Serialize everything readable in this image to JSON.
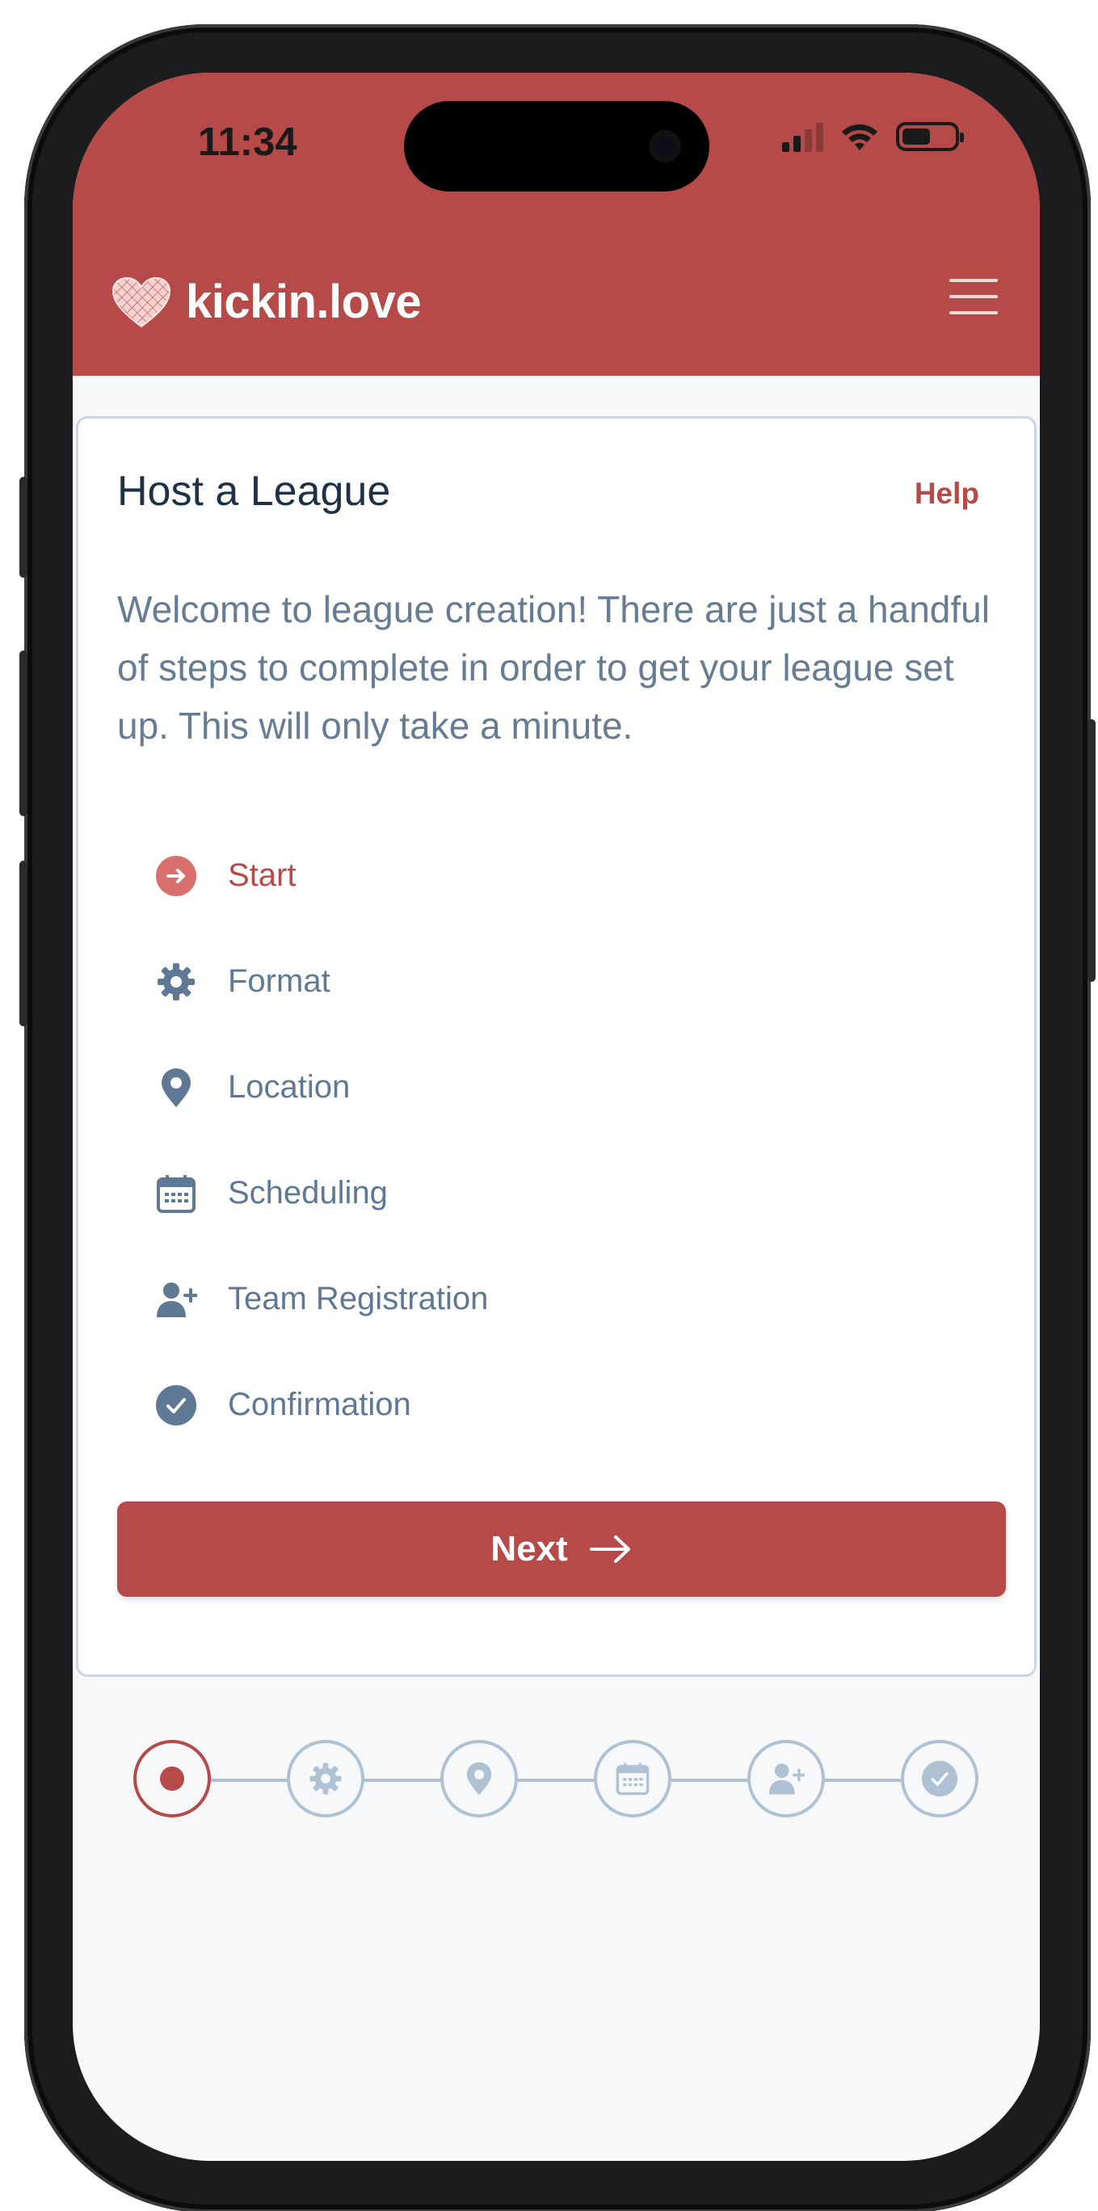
{
  "status_bar": {
    "time": "11:34",
    "icons": [
      "signal-icon",
      "wifi-icon",
      "battery-icon"
    ]
  },
  "header": {
    "brand": "kickin.love",
    "logo": "heart-logo-icon",
    "menu_icon": "hamburger-menu-icon"
  },
  "card": {
    "title": "Host a League",
    "help_label": "Help",
    "intro": "Welcome to league creation! There are just a handful of steps to complete in order to get your league set up. This will only take a minute.",
    "steps": [
      {
        "label": "Start",
        "icon": "arrow-right-circle-icon",
        "active": true
      },
      {
        "label": "Format",
        "icon": "gear-icon",
        "active": false
      },
      {
        "label": "Location",
        "icon": "map-pin-icon",
        "active": false
      },
      {
        "label": "Scheduling",
        "icon": "calendar-icon",
        "active": false
      },
      {
        "label": "Team Registration",
        "icon": "user-plus-icon",
        "active": false
      },
      {
        "label": "Confirmation",
        "icon": "check-circle-icon",
        "active": false
      }
    ],
    "next_label": "Next",
    "next_icon": "arrow-right-icon"
  },
  "progress": {
    "current_step": 1,
    "total_steps": 6,
    "icons": [
      "dot-icon",
      "gear-icon",
      "map-pin-icon",
      "calendar-icon",
      "user-plus-icon",
      "check-circle-icon"
    ]
  },
  "colors": {
    "brand": "#b54a48",
    "text_dark": "#1f3146",
    "text_muted": "#667c93",
    "step_inactive": "#5f7894",
    "stepper_inactive": "#aec2d4",
    "background": "#f7f8fa"
  }
}
